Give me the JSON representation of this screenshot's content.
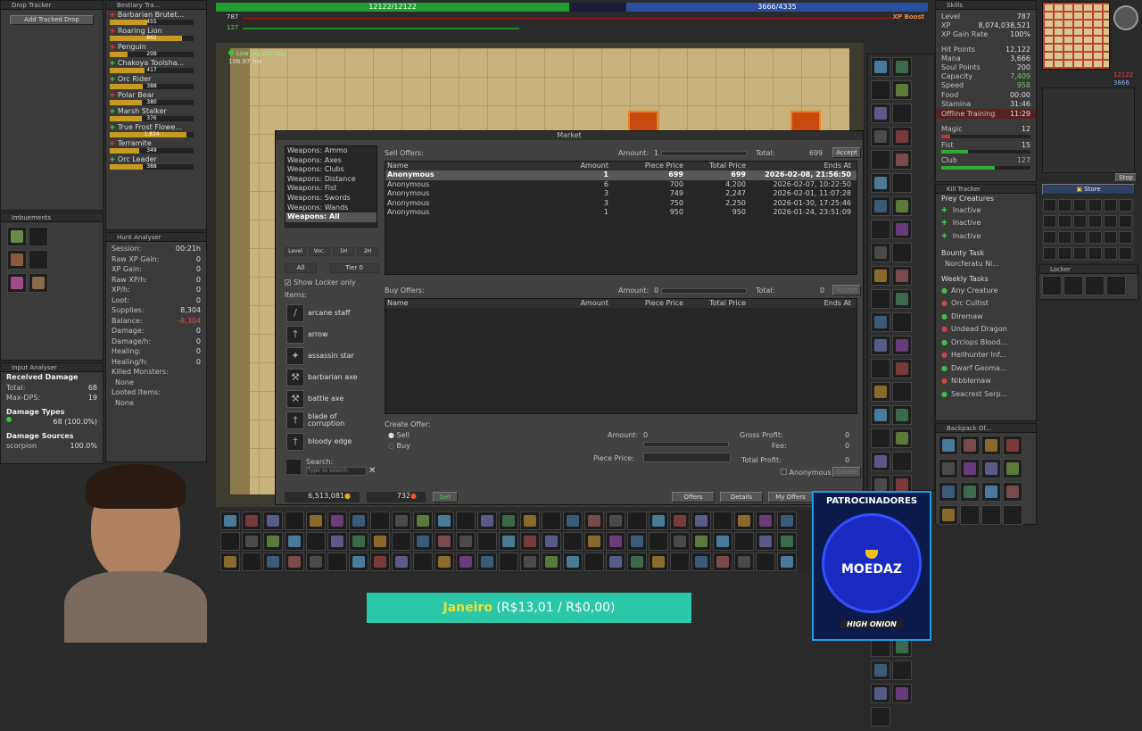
{
  "drop_tracker": {
    "title": "Drop Tracker",
    "add_btn": "Add Tracked Drop"
  },
  "bestiary": {
    "title": "Bestiary Tra...",
    "items": [
      {
        "name": "Barbarian Brutet...",
        "value": "455",
        "fill": 0.45,
        "icon": "red"
      },
      {
        "name": "Roaring Lion",
        "value": "862",
        "fill": 0.86,
        "icon": "red"
      },
      {
        "name": "Penguin",
        "value": "209",
        "fill": 0.21,
        "icon": "red"
      },
      {
        "name": "Chakoya Toolsha...",
        "value": "417",
        "fill": 0.42,
        "icon": "green"
      },
      {
        "name": "Orc Rider",
        "value": "388",
        "fill": 0.39,
        "icon": "green"
      },
      {
        "name": "Polar Bear",
        "value": "380",
        "fill": 0.38,
        "icon": "red"
      },
      {
        "name": "Marsh Stalker",
        "value": "376",
        "fill": 0.38,
        "icon": "green"
      },
      {
        "name": "True Frost Flowe...",
        "value": "1,834",
        "fill": 0.92,
        "icon": "green"
      },
      {
        "name": "Terramite",
        "value": "349",
        "fill": 0.35,
        "icon": "red"
      },
      {
        "name": "Orc Leader",
        "value": "388",
        "fill": 0.39,
        "icon": "green"
      }
    ]
  },
  "imbuements": {
    "title": "Imbuements"
  },
  "hunt": {
    "title": "Hunt Analyser",
    "rows": [
      {
        "k": "Session:",
        "v": "00:21h",
        "c": "#ddd"
      },
      {
        "k": "Raw XP Gain:",
        "v": "0",
        "c": "#ddd"
      },
      {
        "k": "XP Gain:",
        "v": "0",
        "c": "#ddd"
      },
      {
        "k": "Raw XP/h:",
        "v": "0",
        "c": "#ddd"
      },
      {
        "k": "XP/h:",
        "v": "0",
        "c": "#ddd"
      },
      {
        "k": "Loot:",
        "v": "0",
        "c": "#ddd"
      },
      {
        "k": "Supplies:",
        "v": "8,304",
        "c": "#ddd"
      },
      {
        "k": "Balance:",
        "v": "-8,304",
        "c": "#e05050"
      },
      {
        "k": "Damage:",
        "v": "0",
        "c": "#ddd"
      },
      {
        "k": "Damage/h:",
        "v": "0",
        "c": "#ddd"
      },
      {
        "k": "Healing:",
        "v": "0",
        "c": "#ddd"
      },
      {
        "k": "Healing/h:",
        "v": "0",
        "c": "#ddd"
      }
    ],
    "killed_label": "Killed Monsters:",
    "killed_value": "None",
    "looted_label": "Looted Items:",
    "looted_value": "None"
  },
  "input_analyser": {
    "title": "Input Analyser",
    "received": "Received Damage",
    "total_k": "Total:",
    "total_v": "68",
    "maxdps_k": "Max-DPS:",
    "maxdps_v": "19",
    "types_label": "Damage Types",
    "type_value": "68 (100.0%)",
    "sources_label": "Damage Sources",
    "source_name": "scorpion",
    "source_pct": "100.0%"
  },
  "top": {
    "hp": "12122/12122",
    "mana": "3666/4335",
    "xp_boost": "XP Boost",
    "level_small": "787",
    "stamina_small": "127",
    "hp_fill": 0.55,
    "mana_fill": 0.85
  },
  "game": {
    "ping": "Low lag (61 ms)",
    "fps": "106.97 fps"
  },
  "market": {
    "title": "Market",
    "categories": [
      "Weapons: Ammo",
      "Weapons: Axes",
      "Weapons: Clubs",
      "Weapons: Distance",
      "Weapons: Fist",
      "Weapons: Swords",
      "Weapons: Wands",
      "Weapons: All"
    ],
    "filters": [
      "Level",
      "Voc.",
      "1H",
      "2H"
    ],
    "filter_all": "All",
    "filter_tier": "Tier 0",
    "show_locker": "Show Locker only",
    "items_label": "Items:",
    "items": [
      {
        "name": "arcane staff",
        "icon": "/"
      },
      {
        "name": "arrow",
        "icon": "↑"
      },
      {
        "name": "assassin star",
        "icon": "✦"
      },
      {
        "name": "barbarian axe",
        "icon": "⚒"
      },
      {
        "name": "battle axe",
        "icon": "⚒"
      },
      {
        "name": "blade of corruption",
        "icon": "†"
      },
      {
        "name": "bloody edge",
        "icon": "†"
      }
    ],
    "search_label": "Search:",
    "search_placeholder": "Type to search",
    "sell_label": "Sell Offers:",
    "amount_label": "Amount:",
    "sell_amount": "1",
    "total_label": "Total:",
    "sell_total": "699",
    "accept": "Accept",
    "cols": [
      "Name",
      "Amount",
      "Piece Price",
      "Total Price",
      "Ends At"
    ],
    "sell_offers": [
      {
        "name": "Anonymous",
        "amount": "1",
        "piece": "699",
        "total": "699",
        "ends": "2026-02-08, 21:56:50"
      },
      {
        "name": "Anonymous",
        "amount": "6",
        "piece": "700",
        "total": "4,200",
        "ends": "2026-02-07, 10:22:50"
      },
      {
        "name": "Anonymous",
        "amount": "3",
        "piece": "749",
        "total": "2,247",
        "ends": "2026-02-01, 11:07:28"
      },
      {
        "name": "Anonymous",
        "amount": "3",
        "piece": "750",
        "total": "2,250",
        "ends": "2026-01-30, 17:25:46"
      },
      {
        "name": "Anonymous",
        "amount": "1",
        "piece": "950",
        "total": "950",
        "ends": "2026-01-24, 23:51:09"
      }
    ],
    "buy_label": "Buy Offers:",
    "buy_amount": "0",
    "buy_total": "0",
    "create_label": "Create Offer:",
    "sell_radio": "Sell",
    "buy_radio": "Buy",
    "create_amount_label": "Amount:",
    "create_amount": "0",
    "piece_price_label": "Piece Price:",
    "gross_label": "Gross Profit:",
    "gross": "0",
    "fee_label": "Fee:",
    "fee": "0",
    "total_profit_label": "Total Profit:",
    "total_profit": "0",
    "anonymous_label": "Anonymous",
    "create_btn": "Create",
    "gold": "6,513,081",
    "coins": "732",
    "get_btn": "Get",
    "offers_btn": "Offers",
    "details_btn": "Details",
    "my_offers_btn": "My Offers"
  },
  "skills": {
    "title": "Skills",
    "rows": [
      {
        "k": "Level",
        "v": "787",
        "c": "#ddd"
      },
      {
        "k": "XP",
        "v": "8,074,038,521",
        "c": "#ddd"
      },
      {
        "k": "XP Gain Rate",
        "v": "100%",
        "c": "#ddd"
      },
      {
        "k": "Hit Points",
        "v": "12,122",
        "c": "#ddd"
      },
      {
        "k": "Mana",
        "v": "3,666",
        "c": "#ddd"
      },
      {
        "k": "Soul Points",
        "v": "200",
        "c": "#ddd"
      },
      {
        "k": "Capacity",
        "v": "7,409",
        "c": "#6ccf5a"
      },
      {
        "k": "Speed",
        "v": "958",
        "c": "#6ccf5a"
      },
      {
        "k": "Food",
        "v": "00:00",
        "c": "#ddd"
      },
      {
        "k": "Stamina",
        "v": "31:46",
        "c": "#ddd"
      }
    ],
    "offline": "Offline Training",
    "offline_v": "11:29",
    "magic": "Magic",
    "magic_v": "12",
    "fist": "Fist",
    "fist_v": "15",
    "club": "Club",
    "club_v": "127"
  },
  "kill_tracker": {
    "title": "Kill Tracker",
    "prey": "Prey Creatures",
    "prey_items": [
      "Inactive",
      "Inactive",
      "Inactive"
    ],
    "bounty": "Bounty Task",
    "bounty_item": "Norcferatu Ni...",
    "weekly": "Weekly Tasks",
    "weekly_items": [
      "Any Creature",
      "Orc Cultist",
      "Diremaw",
      "Undead Dragon",
      "Orclops Blood...",
      "Hellhunter Inf...",
      "Dwarf Geoma...",
      "Nibblemaw",
      "Seacrest Serp..."
    ]
  },
  "backpack": {
    "title": "Backpack Of..."
  },
  "minimap": {
    "hp": "12122",
    "mana": "3666",
    "stop": "Stop",
    "store": "Store"
  },
  "locker": {
    "title": "Locker"
  },
  "sponsors": {
    "title": "PATROCINADORES",
    "brand": "MOEDAZ",
    "sub": "HIGH ONION"
  },
  "banner": {
    "month": "Janeiro",
    "amounts": "(R$13,01 / R$0,00)"
  }
}
